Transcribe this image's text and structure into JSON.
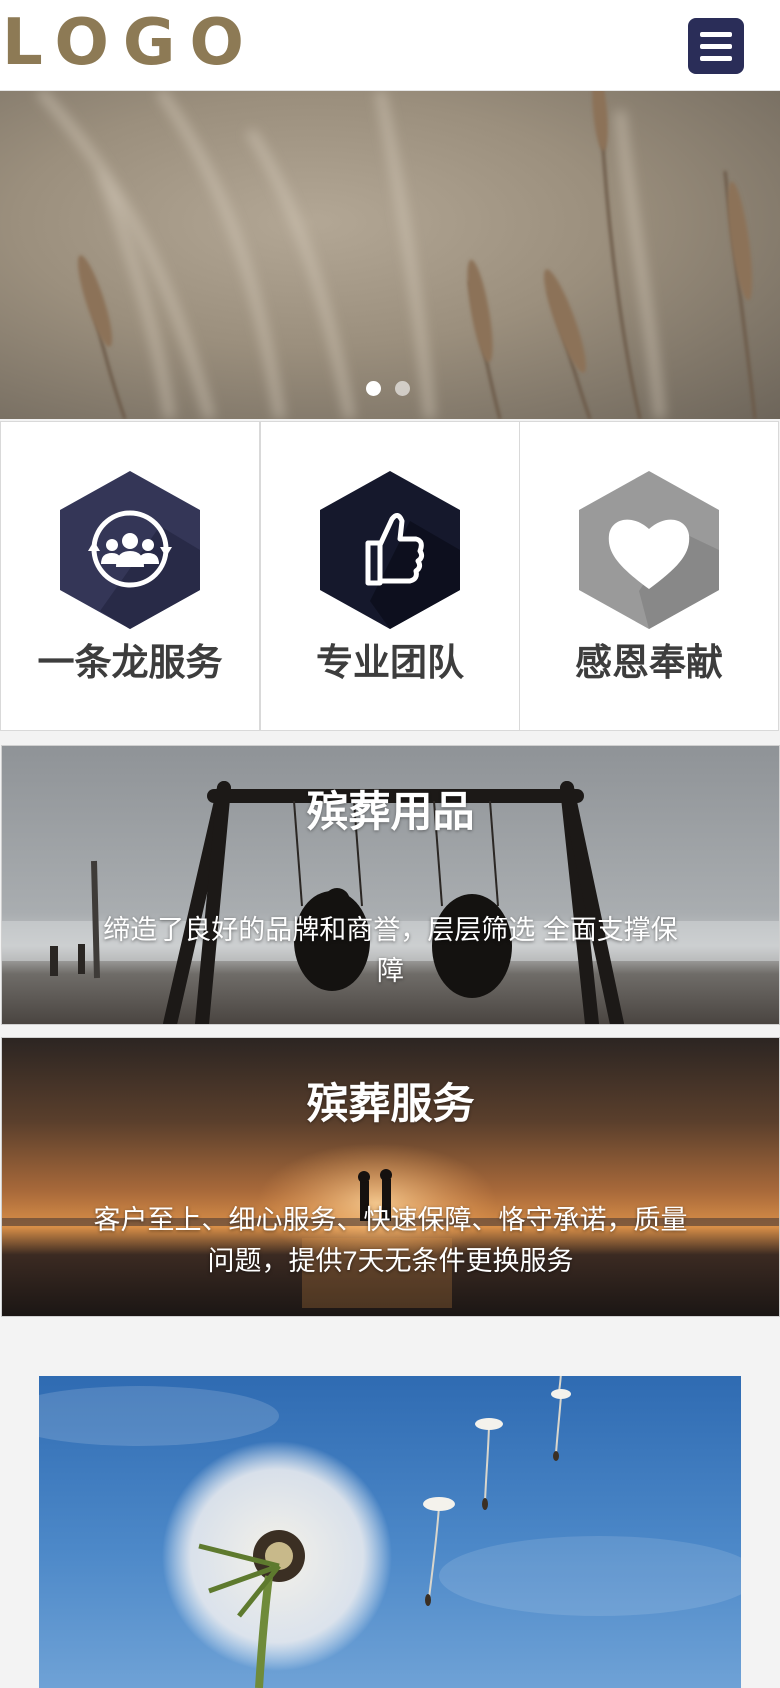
{
  "header": {
    "logo_text": "LOGO",
    "menu_icon": "hamburger-menu-icon"
  },
  "banner": {
    "image": "wheat-grass-field-photo",
    "slide_count": 2,
    "active_slide": 1
  },
  "features": [
    {
      "label": "一条龙服务",
      "icon": "team-cycle-icon",
      "color": "#343657"
    },
    {
      "label": "专业团队",
      "icon": "thumbs-up-icon",
      "color": "#15182c"
    },
    {
      "label": "感恩奉献",
      "icon": "heart-icon",
      "color": "#9a9a9a"
    }
  ],
  "services": [
    {
      "title": "殡葬用品",
      "description": "缔造了良好的品牌和商誉，层层筛选 全面支撑保障",
      "image": "swing-beach-photo"
    },
    {
      "title": "殡葬服务",
      "description": "客户至上、细心服务、快速保障、恪守承诺，质量问题，提供7天无条件更换服务",
      "image": "sunset-couple-beach-photo"
    }
  ],
  "photo": {
    "image": "dandelion-sky-photo"
  },
  "colors": {
    "brand": "#8d7a55",
    "menu_bg": "#2a2d58",
    "page_bg": "#f3f3f3"
  }
}
